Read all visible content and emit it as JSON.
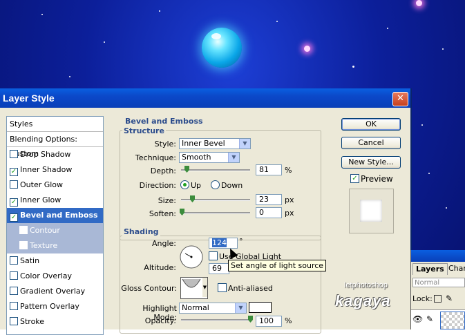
{
  "dialog": {
    "title": "Layer Style",
    "close_glyph": "✕"
  },
  "styles_list": [
    {
      "label": "Styles",
      "type": "header"
    },
    {
      "label": "Blending Options: Custom",
      "type": "header"
    },
    {
      "label": "Drop Shadow",
      "checked": false
    },
    {
      "label": "Inner Shadow",
      "checked": true
    },
    {
      "label": "Outer Glow",
      "checked": false
    },
    {
      "label": "Inner Glow",
      "checked": true
    },
    {
      "label": "Bevel and Emboss",
      "checked": true,
      "selected": true
    },
    {
      "label": "Contour",
      "checked": false,
      "sub": true
    },
    {
      "label": "Texture",
      "checked": false,
      "sub": true
    },
    {
      "label": "Satin",
      "checked": false
    },
    {
      "label": "Color Overlay",
      "checked": false
    },
    {
      "label": "Gradient Overlay",
      "checked": false
    },
    {
      "label": "Pattern Overlay",
      "checked": false
    },
    {
      "label": "Stroke",
      "checked": false
    }
  ],
  "bevel": {
    "section_title": "Bevel and Emboss",
    "structure_title": "Structure",
    "style_label": "Style:",
    "style_value": "Inner Bevel",
    "technique_label": "Technique:",
    "technique_value": "Smooth",
    "depth_label": "Depth:",
    "depth_value": "81",
    "depth_unit": "%",
    "direction_label": "Direction:",
    "dir_up": "Up",
    "dir_down": "Down",
    "direction_selected": "Up",
    "size_label": "Size:",
    "size_value": "23",
    "size_unit": "px",
    "soften_label": "Soften:",
    "soften_value": "0",
    "soften_unit": "px"
  },
  "shading": {
    "title": "Shading",
    "angle_label": "Angle:",
    "angle_value": "124",
    "angle_unit": "°",
    "global_light_label": "Use Global Light",
    "altitude_label": "Altitude:",
    "altitude_value": "69",
    "gloss_label": "Gloss Contour:",
    "anti_aliased_label": "Anti-aliased",
    "highlight_label": "Highlight Mode:",
    "highlight_value": "Normal",
    "highlight_color": "#ffffff",
    "opacity_label": "Opacity:",
    "opacity_value": "100",
    "opacity_unit": "%"
  },
  "tooltip": "Set angle of light source",
  "buttons": {
    "ok": "OK",
    "cancel": "Cancel",
    "new_style": "New Style...",
    "preview_label": "Preview",
    "preview_checked": true
  },
  "layers_panel": {
    "tab_layers": "Layers",
    "tab_channels": "Char",
    "blend_value": "Normal",
    "lock_label": "Lock:"
  },
  "watermark": {
    "small": "letphotoshop",
    "big": "kagaya"
  }
}
